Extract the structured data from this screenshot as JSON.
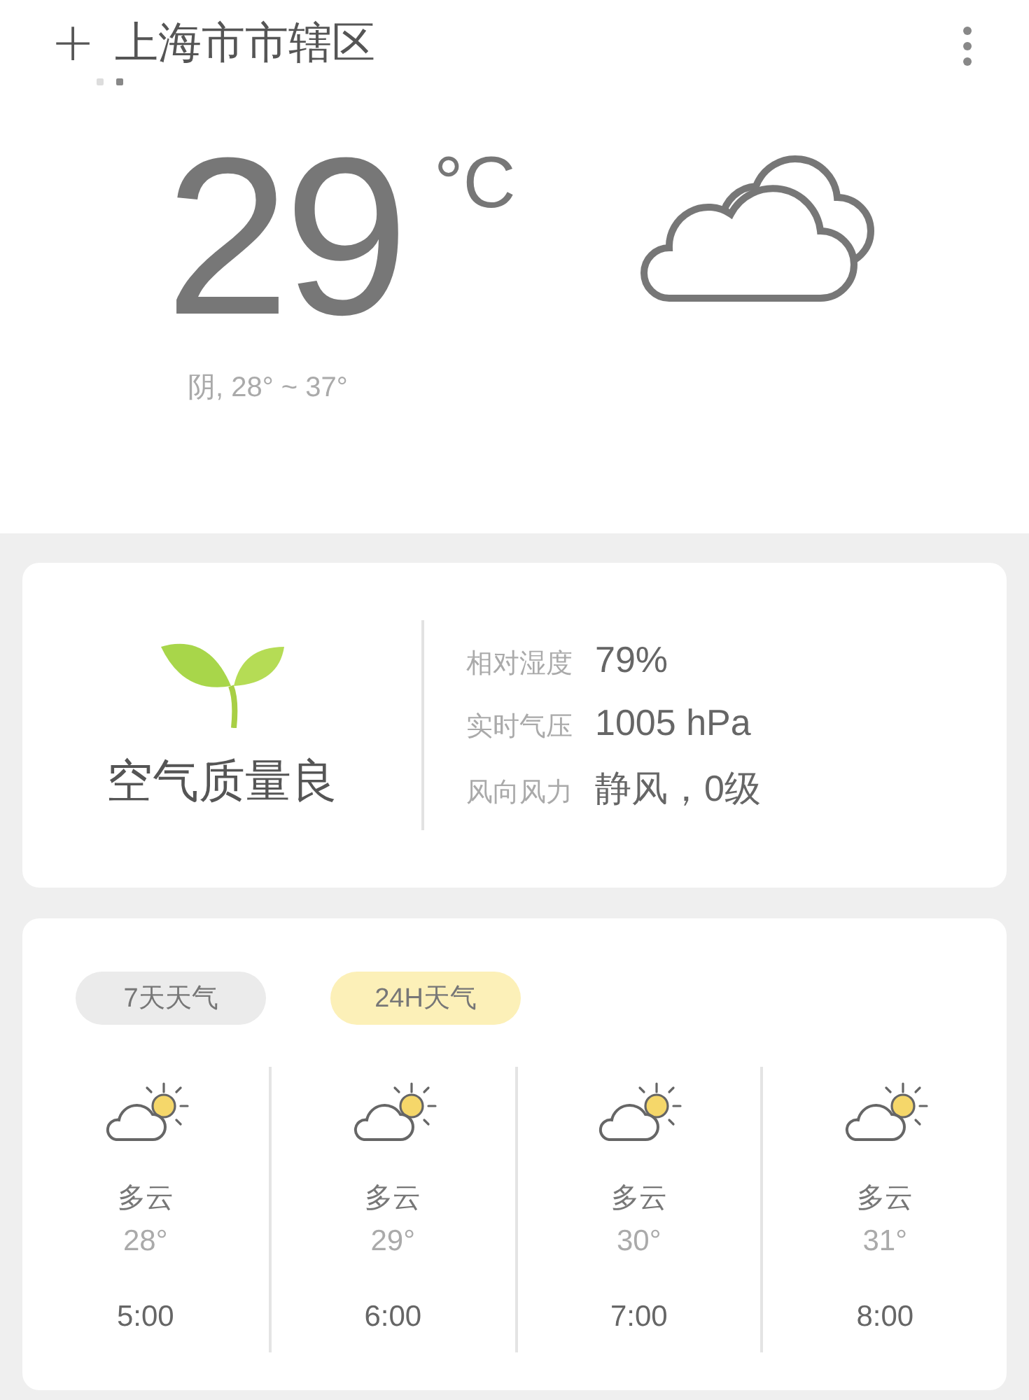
{
  "header": {
    "add_button": "+",
    "city": "上海市市辖区",
    "pages": [
      {
        "selected": false
      },
      {
        "selected": true
      }
    ]
  },
  "current": {
    "temperature": "29",
    "unit": "°C",
    "summary": "阴, 28° ~ 37°"
  },
  "details": {
    "air_quality": "空气质量良",
    "rows": [
      {
        "label": "相对湿度",
        "value": "79%"
      },
      {
        "label": "实时气压",
        "value": "1005 hPa"
      },
      {
        "label": "风向风力",
        "value": "静风，0级"
      }
    ]
  },
  "forecast": {
    "tabs": [
      {
        "label": "7天天气",
        "selected": false
      },
      {
        "label": "24H天气",
        "selected": true
      }
    ],
    "hours": [
      {
        "condition": "多云",
        "temperature": "28°",
        "time": "5:00"
      },
      {
        "condition": "多云",
        "temperature": "29°",
        "time": "6:00"
      },
      {
        "condition": "多云",
        "temperature": "30°",
        "time": "7:00"
      },
      {
        "condition": "多云",
        "temperature": "31°",
        "time": "8:00"
      }
    ]
  }
}
